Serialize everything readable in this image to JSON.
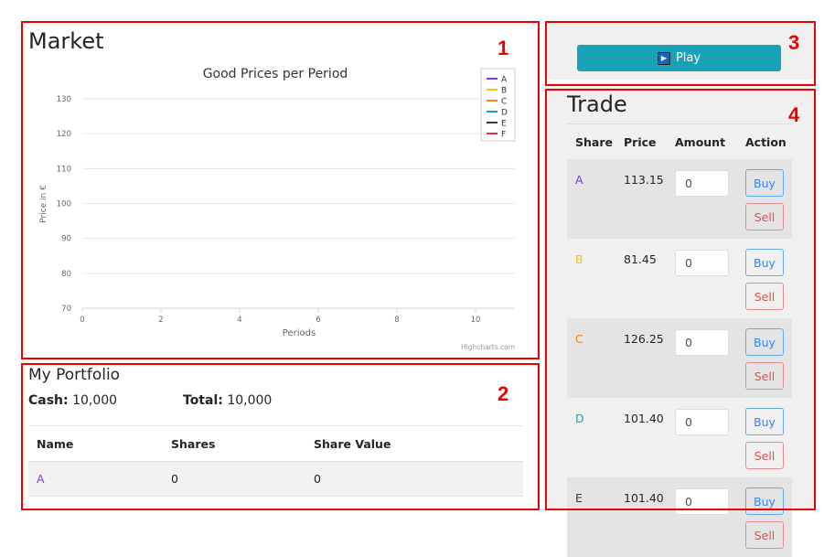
{
  "market": {
    "title": "Market"
  },
  "chart_data": {
    "type": "line",
    "title": "Good Prices per Period",
    "xlabel": "Periods",
    "ylabel": "Price in €",
    "xlim": [
      0,
      11
    ],
    "ylim": [
      70,
      130
    ],
    "xticks": [
      0,
      2,
      4,
      6,
      8,
      10
    ],
    "yticks": [
      70,
      80,
      90,
      100,
      110,
      120,
      130
    ],
    "grid": true,
    "legend_position": "top-right",
    "series": [
      {
        "name": "A",
        "color": "#7c3aed",
        "values": []
      },
      {
        "name": "B",
        "color": "#ffc107",
        "values": []
      },
      {
        "name": "C",
        "color": "#fd7e14",
        "values": []
      },
      {
        "name": "D",
        "color": "#17a2b8",
        "values": []
      },
      {
        "name": "E",
        "color": "#343a40",
        "values": []
      },
      {
        "name": "F",
        "color": "#dc3545",
        "values": []
      }
    ],
    "credits": "Highcharts.com"
  },
  "portfolio": {
    "title": "My Portfolio",
    "cash_label": "Cash:",
    "cash": "10,000",
    "total_label": "Total:",
    "total": "10,000",
    "headers": [
      "Name",
      "Shares",
      "Share Value"
    ],
    "rows": [
      {
        "name": "A",
        "shares": "0",
        "value": "0"
      }
    ]
  },
  "play": {
    "label": "Play"
  },
  "trade": {
    "title": "Trade",
    "headers": [
      "Share",
      "Price",
      "Amount",
      "Action"
    ],
    "buy": "Buy",
    "sell": "Sell",
    "rows": [
      {
        "share": "A",
        "price": "113.15",
        "amount": "0",
        "color": "#7c3aed"
      },
      {
        "share": "B",
        "price": "81.45",
        "amount": "0",
        "color": "#ffc107"
      },
      {
        "share": "C",
        "price": "126.25",
        "amount": "0",
        "color": "#fd7e14"
      },
      {
        "share": "D",
        "price": "101.40",
        "amount": "0",
        "color": "#17a2b8"
      },
      {
        "share": "E",
        "price": "101.40",
        "amount": "0",
        "color": "#343a40"
      }
    ]
  },
  "annotations": [
    "1",
    "2",
    "3",
    "4"
  ]
}
